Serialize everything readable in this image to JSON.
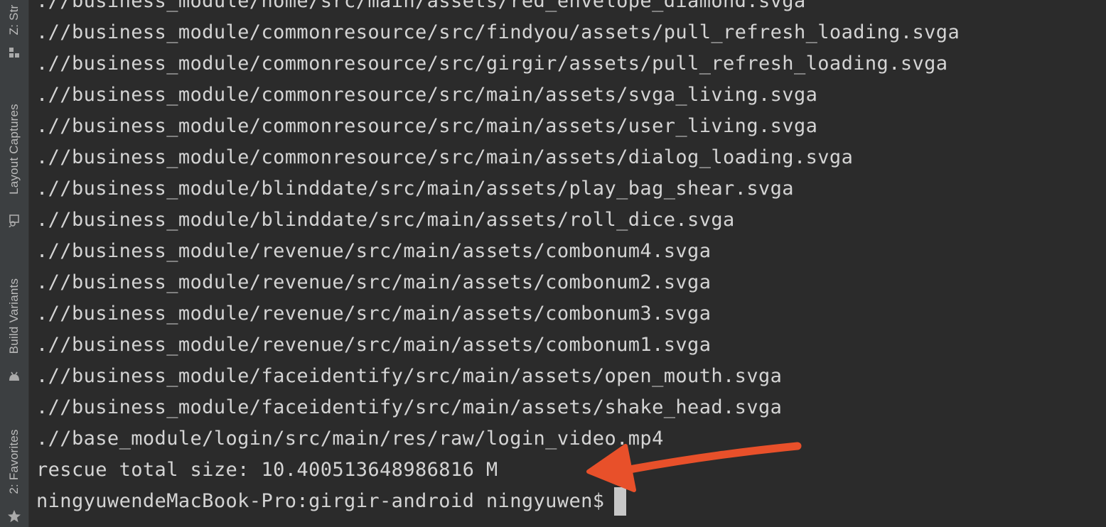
{
  "sidebar": {
    "tabs": [
      {
        "label": "Z: Str",
        "icon": "structure-icon"
      },
      {
        "label": "Layout Captures",
        "icon": "layout-captures-icon"
      },
      {
        "label": "Build Variants",
        "icon": "android-icon"
      },
      {
        "label": "2: Favorites",
        "icon": "star-icon"
      }
    ]
  },
  "terminal": {
    "lines": [
      ".//business_module/home/src/main/assets/red_envelope_diamond.svga",
      ".//business_module/commonresource/src/findyou/assets/pull_refresh_loading.svga",
      ".//business_module/commonresource/src/girgir/assets/pull_refresh_loading.svga",
      ".//business_module/commonresource/src/main/assets/svga_living.svga",
      ".//business_module/commonresource/src/main/assets/user_living.svga",
      ".//business_module/commonresource/src/main/assets/dialog_loading.svga",
      ".//business_module/blinddate/src/main/assets/play_bag_shear.svga",
      ".//business_module/blinddate/src/main/assets/roll_dice.svga",
      ".//business_module/revenue/src/main/assets/combonum4.svga",
      ".//business_module/revenue/src/main/assets/combonum2.svga",
      ".//business_module/revenue/src/main/assets/combonum3.svga",
      ".//business_module/revenue/src/main/assets/combonum1.svga",
      ".//business_module/faceidentify/src/main/assets/open_mouth.svga",
      ".//business_module/faceidentify/src/main/assets/shake_head.svga",
      ".//base_module/login/src/main/res/raw/login_video.mp4",
      "rescue total size: 10.400513648986816 M"
    ],
    "prompt": "ningyuwendeMacBook-Pro:girgir-android ningyuwen$"
  },
  "colors": {
    "background": "#2b2b2b",
    "sidebar": "#3c3f41",
    "text": "#d4d4d4",
    "arrow": "#e8502a"
  }
}
